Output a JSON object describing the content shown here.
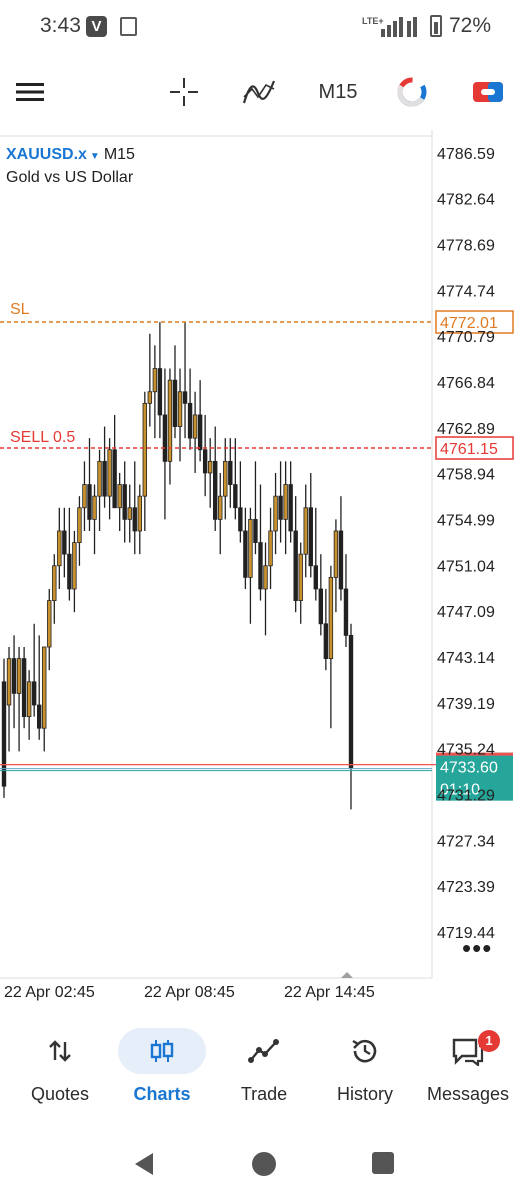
{
  "status_bar": {
    "time": "3:43",
    "notif_badge": "V",
    "network": "LTE+",
    "battery": "72%"
  },
  "toolbar": {
    "timeframe": "M15",
    "icons": [
      "menu-icon",
      "crosshair-icon",
      "indicators-icon",
      "objects-icon",
      "trade-icon"
    ]
  },
  "chart": {
    "symbol": "XAUUSD.x",
    "timeframe": "M15",
    "description": "Gold vs US Dollar",
    "more": "•••",
    "sl_label": "SL",
    "sl_price": "4772.01",
    "sell_label": "SELL 0.5",
    "sell_price": "4761.15",
    "bid_price": "4733.60",
    "countdown": "01:10",
    "colors": {
      "sl": "#e07b24",
      "sell": "#e53935",
      "bid_bg": "#26a69a",
      "bull": "#c8912e",
      "bear": "#212121"
    }
  },
  "chart_data": {
    "type": "candlestick",
    "y_ticks": [
      "4786.59",
      "4782.64",
      "4778.69",
      "4774.74",
      "4770.79",
      "4766.84",
      "4762.89",
      "4758.94",
      "4754.99",
      "4751.04",
      "4747.09",
      "4743.14",
      "4739.19",
      "4735.24",
      "4731.29",
      "4727.34",
      "4723.39",
      "4719.44"
    ],
    "x_ticks": [
      "22 Apr 02:45",
      "22 Apr 08:45",
      "22 Apr 14:45"
    ],
    "ylim": [
      4715.47,
      4788.56
    ],
    "levels": {
      "sl": 4772.01,
      "sell": 4761.15,
      "bid": 4733.6
    },
    "candles": [
      [
        4741,
        4743,
        4731,
        4732
      ],
      [
        4739,
        4744,
        4735,
        4743
      ],
      [
        4743,
        4745,
        4737,
        4740
      ],
      [
        4740,
        4744,
        4735,
        4743
      ],
      [
        4743,
        4744,
        4737,
        4738
      ],
      [
        4738,
        4742,
        4736,
        4741
      ],
      [
        4741,
        4746,
        4738,
        4739
      ],
      [
        4739,
        4745,
        4736,
        4737
      ],
      [
        4737,
        4744,
        4735,
        4744
      ],
      [
        4744,
        4749,
        4742,
        4748
      ],
      [
        4748,
        4752,
        4746,
        4751
      ],
      [
        4751,
        4756,
        4749,
        4754
      ],
      [
        4754,
        4756,
        4750,
        4752
      ],
      [
        4752,
        4756,
        4748,
        4749
      ],
      [
        4749,
        4754,
        4747,
        4753
      ],
      [
        4753,
        4757,
        4751,
        4756
      ],
      [
        4756,
        4760,
        4754,
        4758
      ],
      [
        4758,
        4762,
        4754,
        4755
      ],
      [
        4755,
        4758,
        4752,
        4757
      ],
      [
        4757,
        4761,
        4754,
        4760
      ],
      [
        4760,
        4763,
        4756,
        4757
      ],
      [
        4757,
        4762,
        4755,
        4761
      ],
      [
        4761,
        4764,
        4756,
        4756
      ],
      [
        4756,
        4759,
        4754,
        4758
      ],
      [
        4758,
        4760,
        4753,
        4755
      ],
      [
        4755,
        4758,
        4753,
        4756
      ],
      [
        4756,
        4760,
        4752,
        4754
      ],
      [
        4754,
        4758,
        4752,
        4757
      ],
      [
        4757,
        4766,
        4754,
        4765
      ],
      [
        4765,
        4771,
        4763,
        4766
      ],
      [
        4766,
        4770,
        4762,
        4768
      ],
      [
        4768,
        4772,
        4762,
        4764
      ],
      [
        4764,
        4768,
        4755,
        4760
      ],
      [
        4760,
        4768,
        4758,
        4767
      ],
      [
        4767,
        4770,
        4762,
        4763
      ],
      [
        4763,
        4768,
        4760,
        4766
      ],
      [
        4766,
        4772,
        4762,
        4765
      ],
      [
        4765,
        4768,
        4761,
        4762
      ],
      [
        4762,
        4766,
        4759,
        4764
      ],
      [
        4764,
        4767,
        4760,
        4761
      ],
      [
        4761,
        4764,
        4757,
        4759
      ],
      [
        4759,
        4762,
        4756,
        4760
      ],
      [
        4760,
        4763,
        4754,
        4755
      ],
      [
        4755,
        4759,
        4752,
        4757
      ],
      [
        4757,
        4762,
        4755,
        4760
      ],
      [
        4760,
        4762,
        4756,
        4758
      ],
      [
        4758,
        4762,
        4755,
        4756
      ],
      [
        4756,
        4760,
        4753,
        4754
      ],
      [
        4754,
        4756,
        4749,
        4750
      ],
      [
        4750,
        4756,
        4746,
        4755
      ],
      [
        4755,
        4760,
        4752,
        4753
      ],
      [
        4753,
        4758,
        4748,
        4749
      ],
      [
        4749,
        4753,
        4745,
        4751
      ],
      [
        4751,
        4756,
        4749,
        4754
      ],
      [
        4754,
        4759,
        4752,
        4757
      ],
      [
        4757,
        4760,
        4753,
        4755
      ],
      [
        4755,
        4760,
        4752,
        4758
      ],
      [
        4758,
        4760,
        4753,
        4754
      ],
      [
        4754,
        4757,
        4747,
        4748
      ],
      [
        4748,
        4753,
        4746,
        4752
      ],
      [
        4752,
        4758,
        4750,
        4756
      ],
      [
        4756,
        4759,
        4750,
        4751
      ],
      [
        4751,
        4756,
        4748,
        4749
      ],
      [
        4749,
        4752,
        4745,
        4746
      ],
      [
        4746,
        4749,
        4742,
        4743
      ],
      [
        4743,
        4751,
        4737,
        4750
      ],
      [
        4750,
        4755,
        4747,
        4754
      ],
      [
        4754,
        4757,
        4748,
        4749
      ],
      [
        4749,
        4752,
        4744,
        4745
      ],
      [
        4745,
        4746,
        4730,
        4733.6
      ]
    ]
  },
  "bottom_nav": {
    "items": [
      {
        "label": "Quotes",
        "icon": "arrows-updown-icon"
      },
      {
        "label": "Charts",
        "icon": "candles-icon"
      },
      {
        "label": "Trade",
        "icon": "trade-line-icon"
      },
      {
        "label": "History",
        "icon": "history-icon"
      },
      {
        "label": "Messages",
        "icon": "messages-icon",
        "badge": "1"
      }
    ]
  }
}
